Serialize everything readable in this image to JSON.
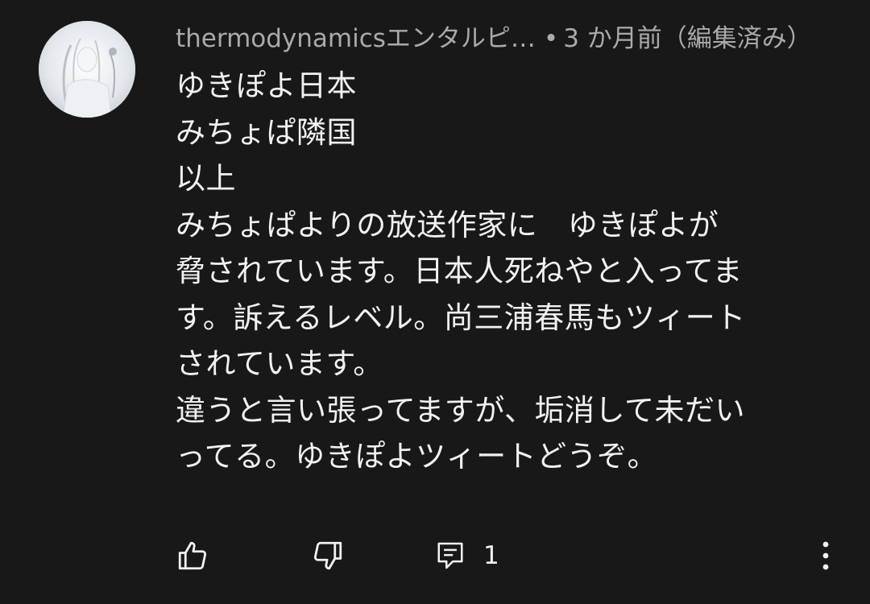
{
  "comment": {
    "author": "thermodynamicsエンタルピ…",
    "separator": "•",
    "time": "3 か月前（編集済み）",
    "lines": [
      "ゆきぽよ日本",
      "みちょぱ隣国",
      "以上",
      "みちょぱよりの放送作家に　ゆきぽよが",
      "脅されています。日本人死ねやと入ってま",
      "す。訴えるレベル。尚三浦春馬もツィート",
      "されています。",
      "違うと言い張ってますが、垢消して未だい",
      "ってる。ゆきぽよツィートどうぞ。"
    ],
    "reply_count": "1"
  },
  "icons": {
    "like": "thumbs-up-icon",
    "dislike": "thumbs-down-icon",
    "reply": "reply-comment-icon",
    "menu": "more-vertical-icon"
  },
  "colors": {
    "background": "#181818",
    "text_primary": "#f1f1f1",
    "text_secondary": "#aaaaaa"
  }
}
